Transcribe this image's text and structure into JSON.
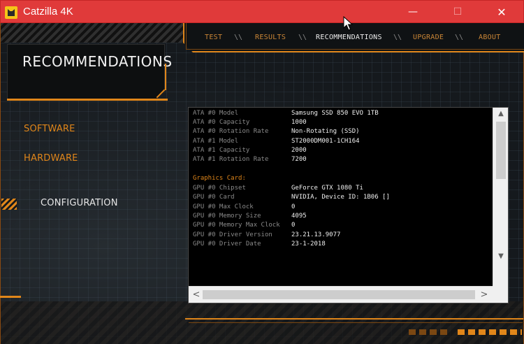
{
  "window": {
    "title": "Catzilla 4K",
    "controls": {
      "minimize": "—",
      "maximize": "☐",
      "close": "✕"
    }
  },
  "nav": {
    "items": [
      "TEST",
      "RESULTS",
      "RECOMMENDATIONS",
      "UPGRADE",
      "ABOUT"
    ],
    "separator": "\\\\",
    "active": "RECOMMENDATIONS"
  },
  "sidebar": {
    "title": "RECOMMENDATIONS",
    "items": [
      "SOFTWARE",
      "HARDWARE",
      "CONFIGURATION"
    ],
    "active": "CONFIGURATION"
  },
  "details": {
    "storage": [
      {
        "key": "ATA #0 Model",
        "value": "Samsung SSD 850 EVO 1TB"
      },
      {
        "key": "ATA #0 Capacity",
        "value": "1000"
      },
      {
        "key": "ATA #0 Rotation Rate",
        "value": "Non-Rotating (SSD)"
      },
      {
        "key": "ATA #1 Model",
        "value": "ST2000DM001-1CH164"
      },
      {
        "key": "ATA #1 Capacity",
        "value": "2000"
      },
      {
        "key": "ATA #1 Rotation Rate",
        "value": "7200"
      }
    ],
    "graphics_heading": "Graphics Card:",
    "graphics": [
      {
        "key": "GPU #0 Chipset",
        "value": "GeForce GTX 1080 Ti"
      },
      {
        "key": "GPU #0 Card",
        "value": "NVIDIA, Device ID: 1B06 []"
      },
      {
        "key": "GPU #0 Max Clock",
        "value": "0"
      },
      {
        "key": "GPU #0 Memory Size",
        "value": "4095"
      },
      {
        "key": "GPU #0 Memory Max Clock",
        "value": "0"
      },
      {
        "key": "GPU #0 Driver Version",
        "value": "23.21.13.9077"
      },
      {
        "key": "GPU #0 Driver Date",
        "value": "23-1-2018"
      }
    ]
  },
  "scrollbars": {
    "up": "▲",
    "down": "▼",
    "left": "<",
    "right": ">"
  },
  "colors": {
    "accent": "#e0861a",
    "titlebar": "#e03a3a",
    "background": "#15191d"
  }
}
